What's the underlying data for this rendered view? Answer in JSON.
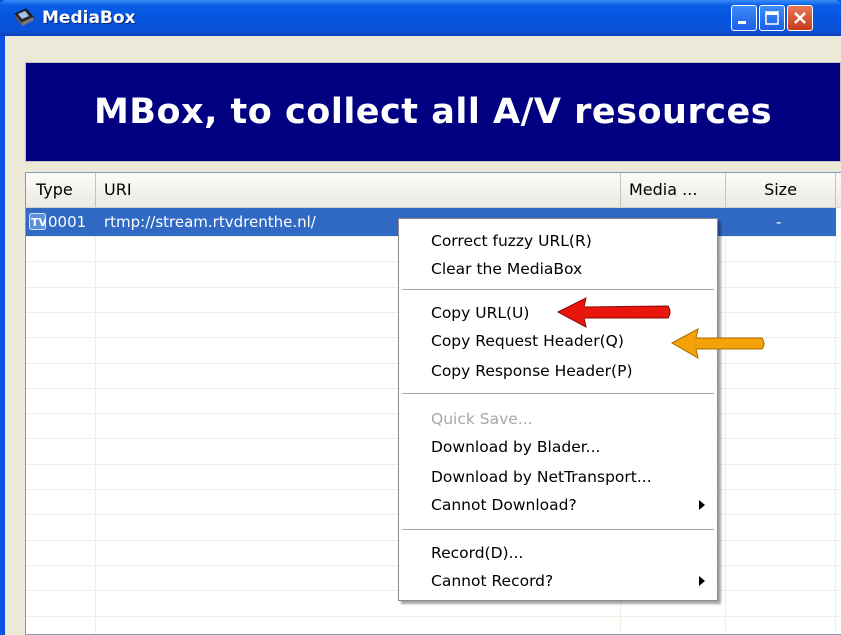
{
  "window": {
    "title": "MediaBox",
    "buttons": {
      "minimize": "minimize-icon",
      "maximize": "maximize-icon",
      "close": "close-icon"
    }
  },
  "banner": {
    "text": "MBox, to collect all A/V resources"
  },
  "list": {
    "columns": [
      "Type",
      "URI",
      "Media ...",
      "Size"
    ],
    "rows": [
      {
        "type_icon": "tv-icon",
        "type": "0001",
        "uri": "rtmp://stream.rtvdrenthe.nl/",
        "media": "",
        "size": "-"
      }
    ]
  },
  "context_menu": {
    "groups": [
      [
        {
          "label": "Correct fuzzy URL(R)"
        },
        {
          "label": "Clear the MediaBox"
        }
      ],
      [
        {
          "label": "Copy URL(U)"
        },
        {
          "label": "Copy Request Header(Q)"
        },
        {
          "label": "Copy Response Header(P)"
        }
      ],
      [
        {
          "label": "Quick Save...",
          "disabled": true
        },
        {
          "label": "Download by Blader..."
        },
        {
          "label": "Download by NetTransport..."
        },
        {
          "label": "Cannot Download?",
          "submenu": true
        }
      ],
      [
        {
          "label": "Record(D)..."
        },
        {
          "label": "Cannot Record?",
          "submenu": true
        }
      ]
    ]
  },
  "annotations": {
    "red_arrow_color": "#e8160c",
    "orange_arrow_color": "#f5a20a"
  }
}
